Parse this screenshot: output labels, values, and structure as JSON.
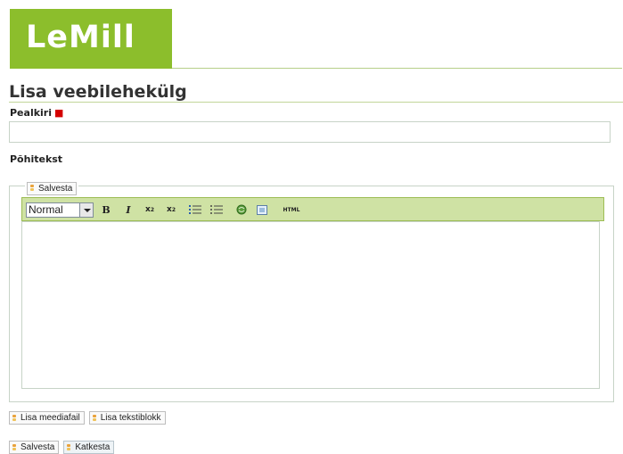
{
  "header": {
    "logo_text": "LeMill",
    "brand_color": "#8cbe2c"
  },
  "page": {
    "title": "Lisa veebilehekülg"
  },
  "form": {
    "title_label": "Pealkiri",
    "required_mark": "■",
    "title_value": "",
    "body_label": "Põhitekst",
    "editor": {
      "fieldset_save_label": "Salvesta",
      "format_selected": "Normal",
      "toolbar_icons": [
        "bold-icon",
        "italic-icon",
        "subscript-icon",
        "superscript-icon",
        "ordered-list-icon",
        "unordered-list-icon",
        "link-icon",
        "image-icon",
        "html-icon"
      ],
      "bold_glyph": "B",
      "italic_glyph": "I",
      "sub_glyph": "x",
      "sub_mark": "2",
      "sup_glyph": "x",
      "sup_mark": "2",
      "html_label": "HTML",
      "body_value": ""
    },
    "add_media_label": "Lisa meediafail",
    "add_textblock_label": "Lisa tekstiblokk",
    "save_label": "Salvesta",
    "cancel_label": "Katkesta"
  }
}
